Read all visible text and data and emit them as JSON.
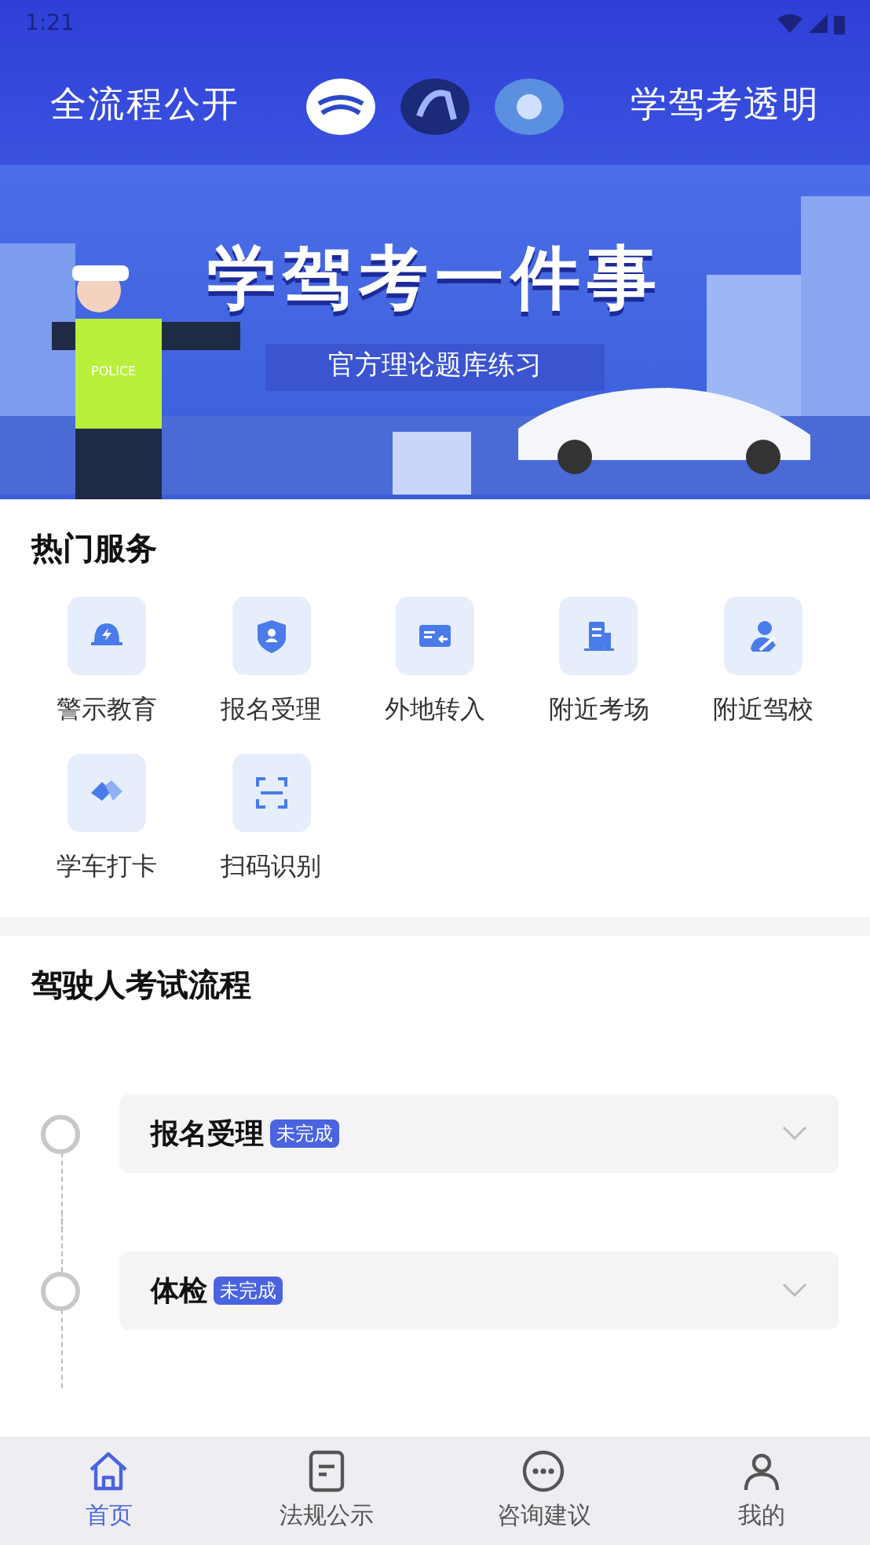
{
  "status_bar": {
    "time": "1:21"
  },
  "header": {
    "left_text": "全流程公开",
    "right_text": "学驾考透明"
  },
  "banner": {
    "title": "学驾考一件事",
    "subtitle": "官方理论题库练习",
    "badge_text": "POLICE"
  },
  "hot_services": {
    "title": "热门服务",
    "items": [
      {
        "label": "警示教育",
        "kind": "alarm"
      },
      {
        "label": "报名受理",
        "kind": "shield"
      },
      {
        "label": "外地转入",
        "kind": "transfer"
      },
      {
        "label": "附近考场",
        "kind": "building"
      },
      {
        "label": "附近驾校",
        "kind": "person"
      },
      {
        "label": "学车打卡",
        "kind": "handshake"
      },
      {
        "label": "扫码识别",
        "kind": "scan"
      }
    ]
  },
  "exam_process": {
    "title": "驾驶人考试流程",
    "steps": [
      {
        "name": "报名受理",
        "status": "未完成",
        "expanded": false
      },
      {
        "name": "体检",
        "status": "未完成",
        "expanded": false
      }
    ]
  },
  "bottom_nav": [
    {
      "label": "首页",
      "kind": "home",
      "selected": true
    },
    {
      "label": "法规公示",
      "kind": "doc",
      "selected": false
    },
    {
      "label": "咨询建议",
      "kind": "chat",
      "selected": false
    },
    {
      "label": "我的",
      "kind": "user",
      "selected": false
    }
  ]
}
